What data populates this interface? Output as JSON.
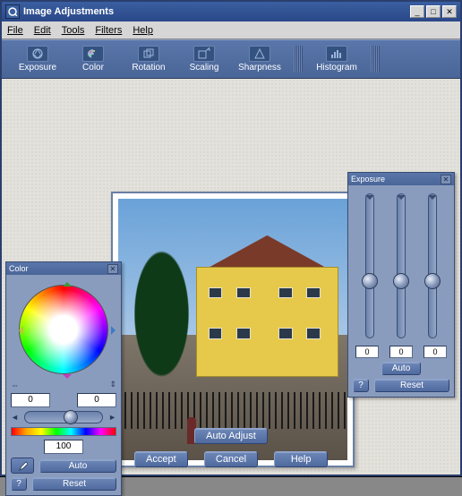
{
  "window": {
    "title": "Image Adjustments"
  },
  "menu": {
    "file": "File",
    "edit": "Edit",
    "tools": "Tools",
    "filters": "Filters",
    "help": "Help"
  },
  "toolbar": [
    {
      "icon": "aperture-icon",
      "label": "Exposure"
    },
    {
      "icon": "palette-icon",
      "label": "Color"
    },
    {
      "icon": "rotate-icon",
      "label": "Rotation"
    },
    {
      "icon": "scale-icon",
      "label": "Scaling"
    },
    {
      "icon": "sharpen-icon",
      "label": "Sharpness"
    },
    {
      "icon": "histogram-icon",
      "label": "Histogram"
    }
  ],
  "color_panel": {
    "title": "Color",
    "hue_value": "0",
    "sat_value": "0",
    "slider_value": "100",
    "auto": "Auto",
    "reset": "Reset",
    "help": "?"
  },
  "exposure_panel": {
    "title": "Exposure",
    "v1": "0",
    "v2": "0",
    "v3": "0",
    "auto": "Auto",
    "reset": "Reset",
    "help": "?"
  },
  "actions": {
    "auto_adjust": "Auto Adjust",
    "accept": "Accept",
    "cancel": "Cancel",
    "help": "Help"
  }
}
